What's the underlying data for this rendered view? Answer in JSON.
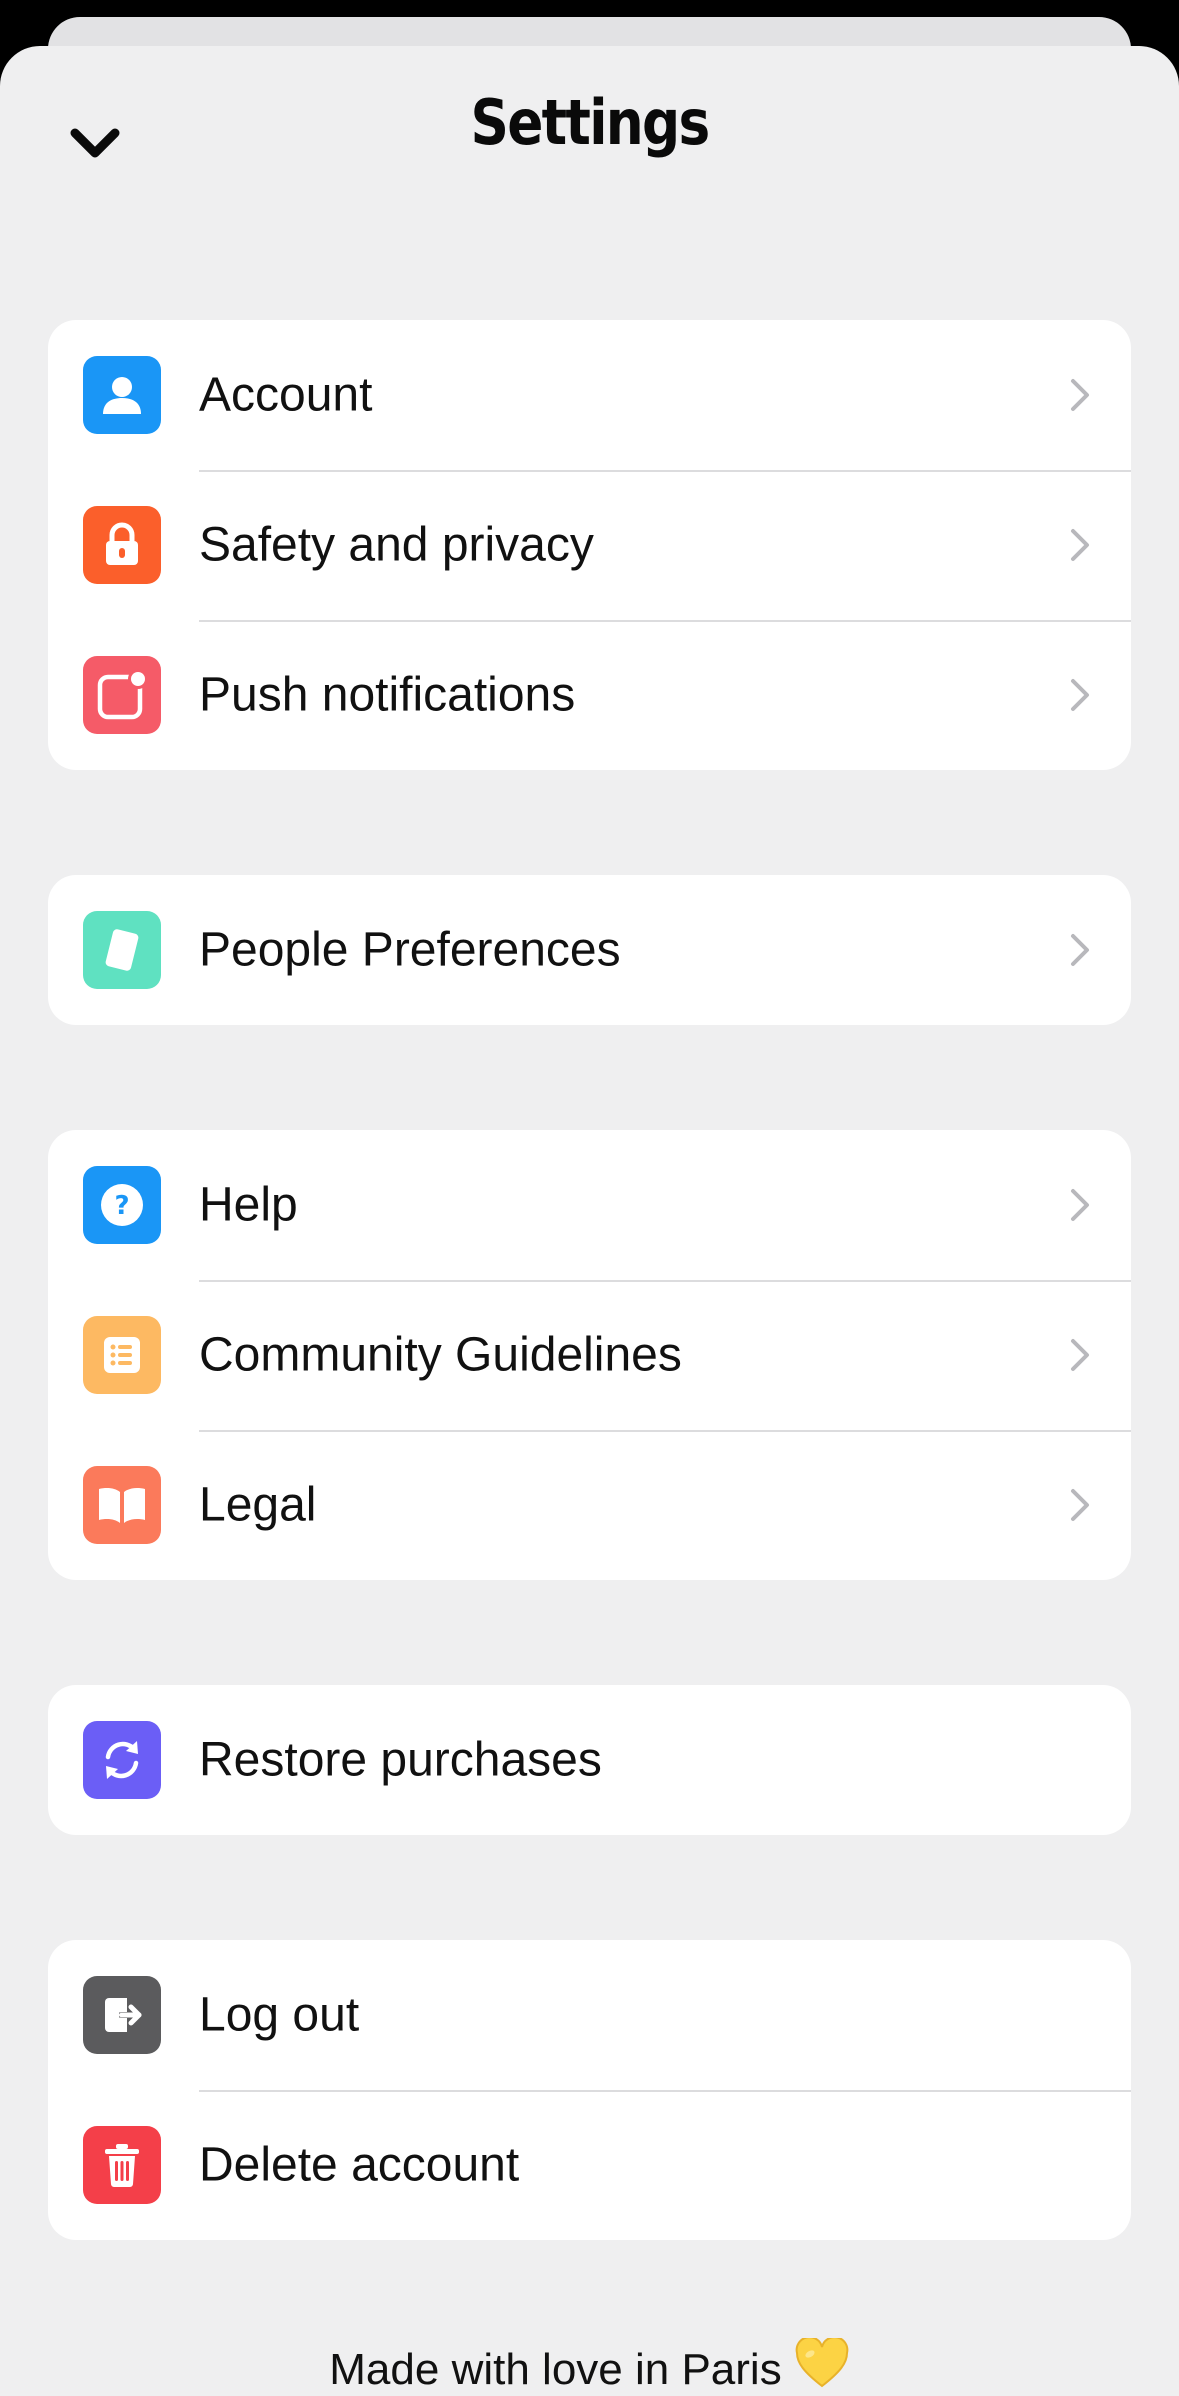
{
  "header": {
    "title": "Settings",
    "collapse_icon": "chevron-down-icon"
  },
  "groups": [
    {
      "items": [
        {
          "label": "Account",
          "icon": "person-icon",
          "color": "#1a96f6",
          "chevron": true
        },
        {
          "label": "Safety and privacy",
          "icon": "lock-icon",
          "color": "#fb5f2b",
          "chevron": true
        },
        {
          "label": "Push notifications",
          "icon": "notification-badge-icon",
          "color": "#f55b68",
          "chevron": true
        }
      ]
    },
    {
      "items": [
        {
          "label": "People Preferences",
          "icon": "card-icon",
          "color": "#5fe1c1",
          "chevron": true
        }
      ]
    },
    {
      "items": [
        {
          "label": "Help",
          "icon": "question-icon",
          "color": "#1a96f6",
          "chevron": true
        },
        {
          "label": "Community Guidelines",
          "icon": "list-icon",
          "color": "#fdb962",
          "chevron": true
        },
        {
          "label": "Legal",
          "icon": "book-icon",
          "color": "#fb7a5b",
          "chevron": true
        }
      ]
    },
    {
      "items": [
        {
          "label": "Restore purchases",
          "icon": "refresh-icon",
          "color": "#6b5ef6",
          "chevron": false
        }
      ]
    },
    {
      "items": [
        {
          "label": "Log out",
          "icon": "logout-icon",
          "color": "#5b5b5d",
          "chevron": false
        },
        {
          "label": "Delete account",
          "icon": "trash-icon",
          "color": "#f43f49",
          "chevron": false
        }
      ]
    }
  ],
  "footer": {
    "text": "Made with love in Paris",
    "emoji_icon": "yellow-heart-icon",
    "heart_color": "#fcd344"
  }
}
